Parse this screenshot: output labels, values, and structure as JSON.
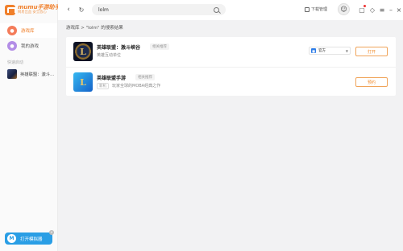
{
  "app": {
    "logo_title": "mumu手游助手",
    "logo_subtitle": "网易出品 安全放心"
  },
  "sidebar": {
    "items": [
      {
        "label": "游戏库",
        "icon": "gamepad-icon",
        "active": true
      },
      {
        "label": "我的游戏",
        "icon": "controller-icon",
        "active": false
      }
    ],
    "section_title": "快速启动",
    "recent": [
      {
        "label": "英雄联盟：激斗..."
      }
    ],
    "bottom_button": {
      "label": "打开模拟器",
      "icon": "mumu-icon"
    }
  },
  "topbar": {
    "search_value": "lolm",
    "download_manager": "下载管理"
  },
  "breadcrumb": "游戏库  >  \"lolm\" 的搜索结果",
  "results": [
    {
      "name": "英雄联盟：激斗峡谷",
      "tag": "相关推荐",
      "desc": "英雄互动单位",
      "badge": "",
      "source": "官方",
      "action": "打开"
    },
    {
      "name": "英雄联盟手游",
      "tag": "相关推荐",
      "desc": "玩家全球的MOBA经典之作",
      "badge": "新机",
      "source": "",
      "action": "预约"
    }
  ],
  "colors": {
    "accent": "#f07f2a",
    "bottom_button": "#2a9ee5"
  }
}
